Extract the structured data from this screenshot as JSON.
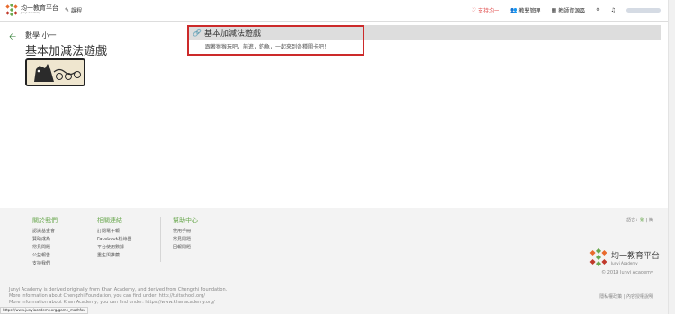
{
  "topbar": {
    "logo_title": "均一教育平台",
    "logo_sub": "Junyi Academy",
    "course_label": "課程",
    "support_label": "支持均一",
    "teaching_mgmt_label": "教學管理",
    "teaching_resources_label": "教師資源區"
  },
  "lesson": {
    "subject": "數學 小一",
    "title": "基本加減法遊戲"
  },
  "content": {
    "item_title": "基本加減法遊戲",
    "item_desc": "跟著猴猴玩吧，前進，釣魚，一起來到各種關卡吧！"
  },
  "footer": {
    "cols": [
      {
        "head": "關於我們",
        "links": [
          "認識基金會",
          "贊助成為",
          "常見問題",
          "公益報告",
          "支持我們"
        ]
      },
      {
        "head": "相關連結",
        "links": [
          "訂閱電子報",
          "Facebook粉絲團",
          "平台使用數據",
          "重生與推薦"
        ]
      },
      {
        "head": "幫助中心",
        "links": [
          "使用手冊",
          "常見問題",
          "回報問題"
        ]
      }
    ],
    "lang_label": "語言：",
    "lang_active": "繁",
    "lang_sep": " | ",
    "lang_other": "簡",
    "logo_title": "均一教育平台",
    "logo_sub": "Junyi Academy",
    "copyright": "© 2019 Junyi Academy",
    "credits": [
      "Junyi Academy is derived originally from Khan Academy, and derived from Chengzhi Foundation.",
      "More information about Chengzhi Foundation, you can find under: http://tuitschool.org/",
      "More information about Khan Academy, you can find under: https://www.khanacademy.org/"
    ],
    "privacy": "隱私權政策 | 內容授權說明"
  },
  "status_url": "https://www.junyiacademy.org/game_mathfox",
  "colors": {
    "accent_green": "#6aa84f",
    "highlight_red": "#cc2a2a",
    "support_red": "#e04848"
  }
}
